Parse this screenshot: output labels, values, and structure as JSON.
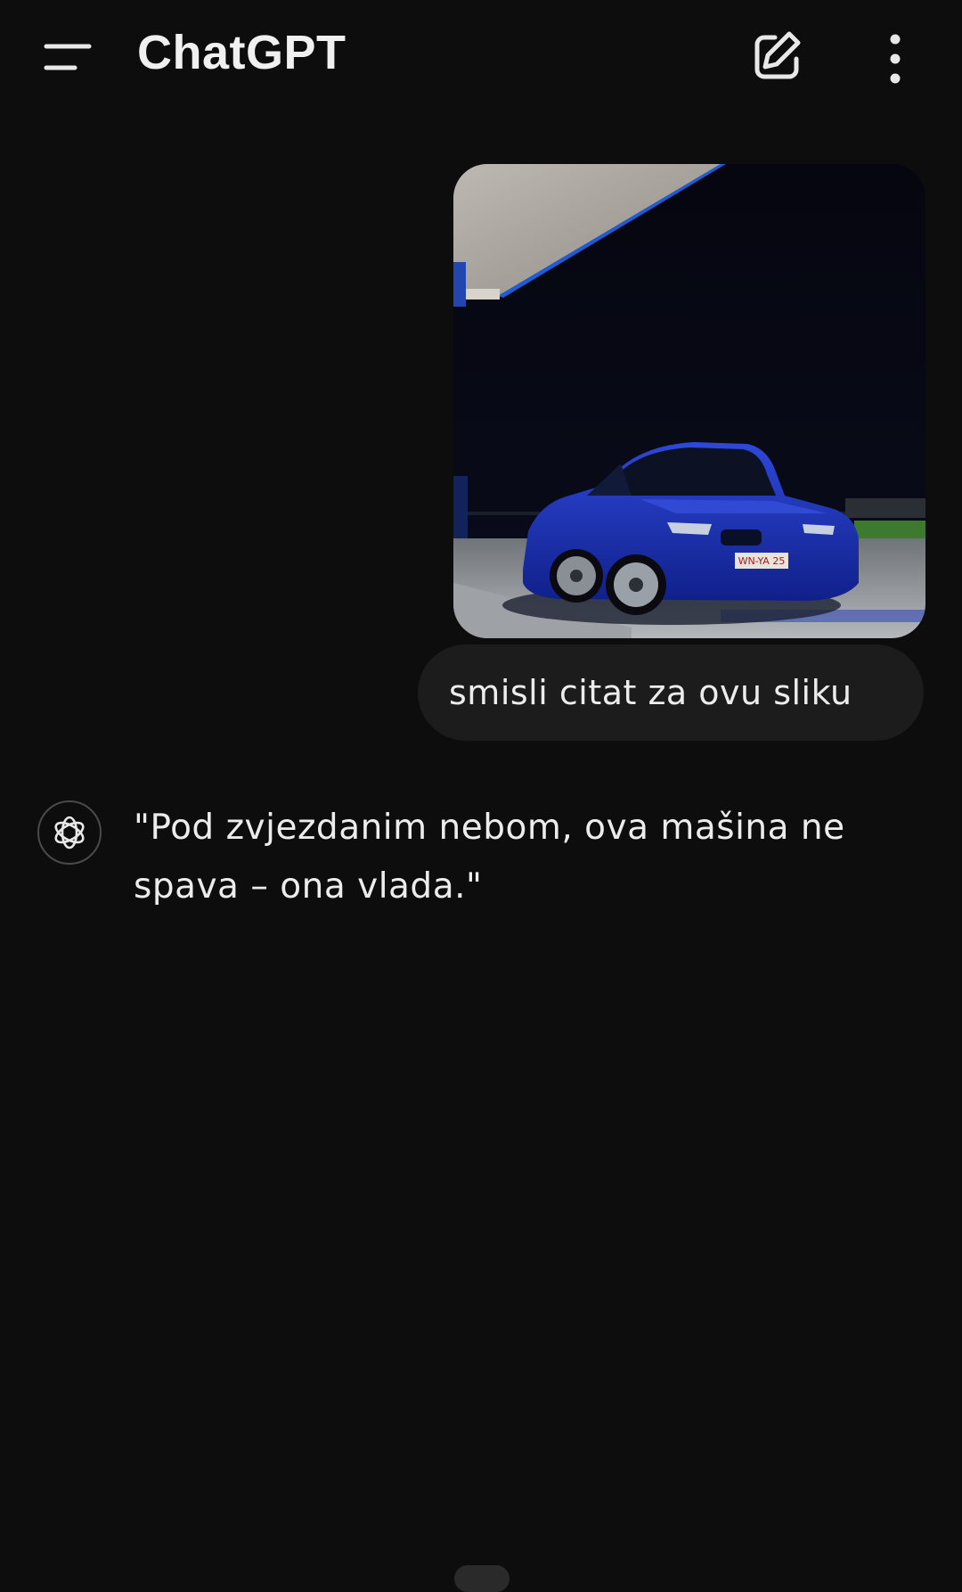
{
  "header": {
    "title": "ChatGPT",
    "menu_icon": "hamburger-menu-icon",
    "new_chat_icon": "edit-pencil-icon",
    "more_icon": "vertical-dots-icon"
  },
  "conversation": {
    "user_message": {
      "image_subject": "blue-sports-car-at-night-gas-station",
      "plate_text": "WN-YA 25",
      "text": "smisli citat za ovu sliku"
    },
    "assistant_message": {
      "avatar_icon": "openai-logo-icon",
      "text": "\"Pod zvjezdanim nebom, ova mašina ne spava – ona vlada.\""
    }
  },
  "colors": {
    "background": "#0d0d0d",
    "bubble": "#1c1c1c",
    "text": "#ececec",
    "car": "#1a2fb0"
  }
}
